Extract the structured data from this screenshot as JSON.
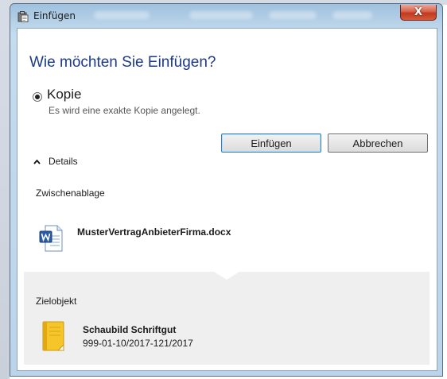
{
  "window": {
    "title": "Einfügen",
    "close_symbol": "X",
    "icon": "paste-icon"
  },
  "dialog": {
    "heading": "Wie möchten Sie Einfügen?",
    "option": {
      "label": "Kopie",
      "description": "Es wird eine exakte Kopie angelegt.",
      "selected": true
    },
    "buttons": {
      "paste": "Einfügen",
      "cancel": "Abbrechen"
    },
    "details_toggle": {
      "caret": "^",
      "label": "Details"
    },
    "clipboard": {
      "label": "Zwischenablage",
      "file_name": "MusterVertragAnbieterFirma.docx",
      "file_icon": "word-document-icon"
    },
    "target": {
      "label": "Zielobjekt",
      "title": "Schaubild Schriftgut",
      "subtitle": "999-01-10/2017-121/2017",
      "icon": "notebook-icon"
    }
  },
  "colors": {
    "heading": "#1c3a8a",
    "close_button": "#c0391f",
    "titlebar": "#bcd4ea",
    "target_panel": "#efefef"
  }
}
